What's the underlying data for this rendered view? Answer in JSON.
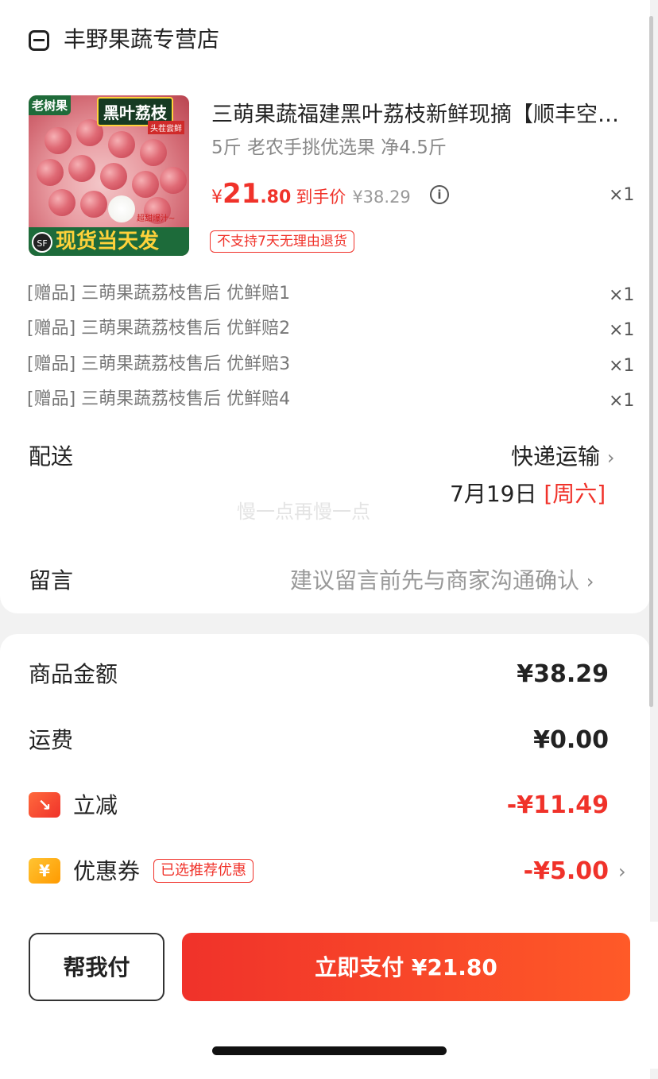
{
  "store": {
    "name": "丰野果蔬专营店",
    "icon": "store-icon"
  },
  "product": {
    "image_tags": {
      "tag1": "老树果",
      "tag2": "黑叶荔枝",
      "tag3": "头茬尝鲜",
      "tag4": "超甜爆汁~",
      "sf": "SF",
      "banner": "现货当天发"
    },
    "title": "三萌果蔬福建黑叶荔枝新鲜现摘【顺丰空运】",
    "spec": "5斤 老农手挑优选果 净4.5斤",
    "price_symbol": "¥",
    "price_int": "21",
    "price_dec": ".80",
    "price_label": "到手价",
    "original_price": "¥38.29",
    "qty": "×1",
    "return_badge": "不支持7天无理由退货"
  },
  "gifts": [
    {
      "label": "[赠品] 三萌果蔬荔枝售后 优鲜赔1",
      "qty": "×1"
    },
    {
      "label": "[赠品] 三萌果蔬荔枝售后 优鲜赔2",
      "qty": "×1"
    },
    {
      "label": "[赠品] 三萌果蔬荔枝售后 优鲜赔3",
      "qty": "×1"
    },
    {
      "label": "[赠品] 三萌果蔬荔枝售后 优鲜赔4",
      "qty": "×1"
    }
  ],
  "delivery": {
    "label": "配送",
    "method": "快递运输",
    "date": "7月19日 ",
    "day": "[周六]"
  },
  "watermark": "慢一点再慢一点",
  "remark": {
    "label": "留言",
    "placeholder": "建议留言前先与商家沟通确认"
  },
  "summary": {
    "goods_label": "商品金额",
    "goods_value": "¥38.29",
    "shipping_label": "运费",
    "shipping_value": "¥0.00",
    "discount_label": "立减",
    "discount_value": "-¥11.49",
    "discount_icon": "↘",
    "coupon_label": "优惠券",
    "coupon_badge": "已选推荐优惠",
    "coupon_value": "-¥5.00",
    "coupon_icon": "¥"
  },
  "actions": {
    "help_pay": "帮我付",
    "pay_now": "立即支付  ¥21.80"
  },
  "chevron": "›",
  "colors": {
    "accent": "#f0322a",
    "background": "#f2f2f2"
  }
}
